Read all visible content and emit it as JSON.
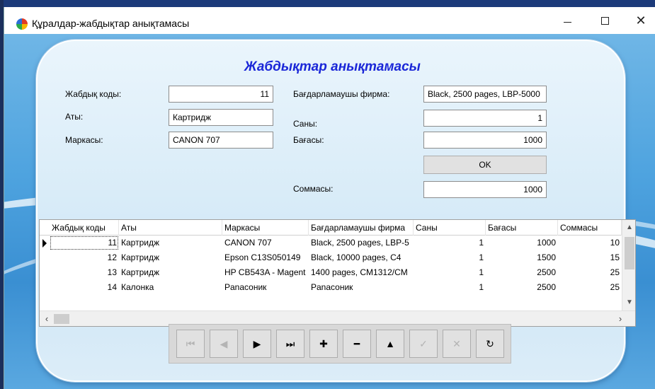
{
  "window": {
    "title": "Құралдар-жабдықтар анықтамасы",
    "minimize_icon": "minimize-icon",
    "maximize_icon": "maximize-icon",
    "close_glyph": "✕"
  },
  "form": {
    "title": "Жабдықтар анықтамасы",
    "labels": {
      "code": "Жабдық коды:",
      "name": "Аты:",
      "brand": "Маркасы:",
      "vendor": "Бағдарламаушы фирма:",
      "qty": "Саны:",
      "price": "Бағасы:",
      "total": "Соммасы:"
    },
    "values": {
      "code": "11",
      "name": "Картридж",
      "brand": "CANON 707",
      "vendor": "Black, 2500 pages, LBP-5000",
      "qty": "1",
      "price": "1000",
      "total": "1000"
    },
    "ok_label": "OK"
  },
  "grid": {
    "columns": [
      "Жабдық коды",
      "Аты",
      "Маркасы",
      "Бағдарламаушы фирма",
      "Саны",
      "Бағасы",
      "Соммасы"
    ],
    "rows": [
      [
        "11",
        "Картридж",
        "CANON 707",
        "Black, 2500 pages, LBP-5",
        "1",
        "1000",
        "10"
      ],
      [
        "12",
        "Картридж",
        "Epson C13S050149",
        "Black, 10000 pages, C4",
        "1",
        "1500",
        "15"
      ],
      [
        "13",
        "Картридж",
        "HP CB543A - Magent",
        "1400 pages, CM1312/CM",
        "1",
        "2500",
        "25"
      ],
      [
        "14",
        "Калонка",
        "Panaсоник",
        "Panaсоник",
        "1",
        "2500",
        "25"
      ]
    ],
    "selected_row": 0
  },
  "navigator": {
    "buttons": [
      {
        "name": "first",
        "glyph": "⏮",
        "enabled": false
      },
      {
        "name": "prior",
        "glyph": "◀",
        "enabled": false
      },
      {
        "name": "next",
        "glyph": "▶",
        "enabled": true
      },
      {
        "name": "last",
        "glyph": "⏭",
        "enabled": true
      },
      {
        "name": "insert",
        "glyph": "✚",
        "enabled": true
      },
      {
        "name": "delete",
        "glyph": "━",
        "enabled": true
      },
      {
        "name": "edit",
        "glyph": "▲",
        "enabled": true
      },
      {
        "name": "post",
        "glyph": "✓",
        "enabled": false
      },
      {
        "name": "cancel",
        "glyph": "✕",
        "enabled": false
      },
      {
        "name": "refresh",
        "glyph": "↻",
        "enabled": true
      }
    ]
  }
}
